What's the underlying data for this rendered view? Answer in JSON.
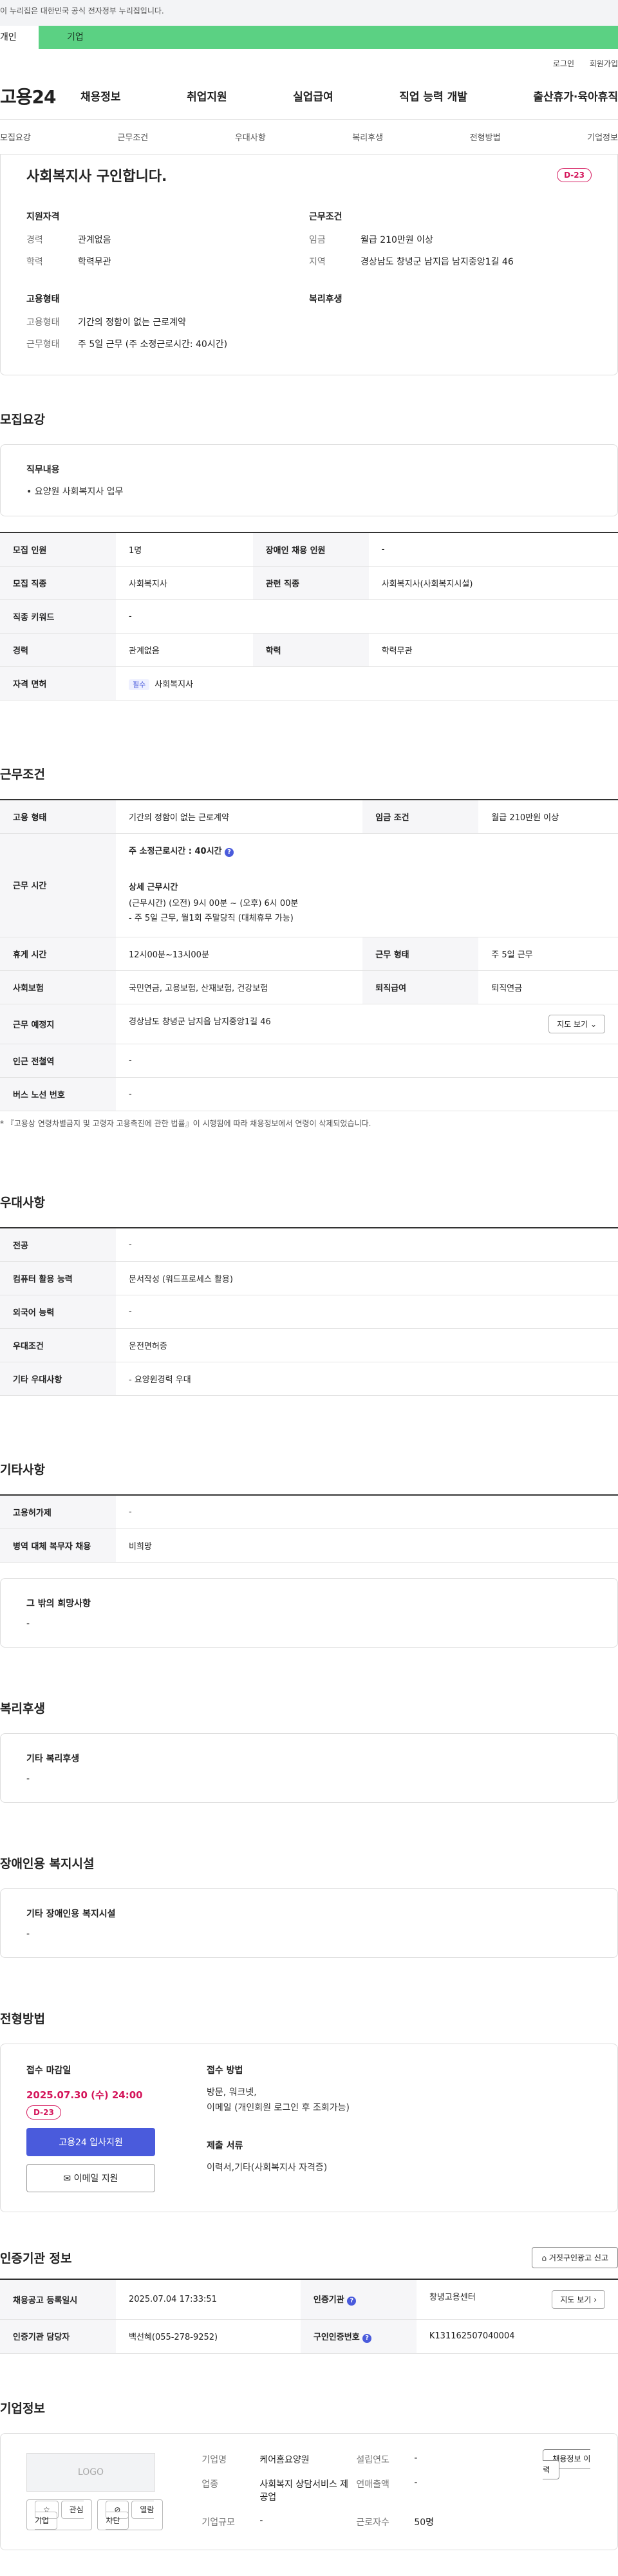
{
  "gov_banner": "이 누리집은 대한민국 공식 전자정부 누리집입니다.",
  "tabs": {
    "individual": "개인",
    "company": "기업"
  },
  "util": {
    "login": "로그인",
    "join": "회원가입"
  },
  "logo": "고용24",
  "gnb": [
    "채용정보",
    "취업지원",
    "실업급여",
    "직업 능력 개발",
    "출산휴가·육아휴직"
  ],
  "snb": [
    "모집요강",
    "근무조건",
    "우대사항",
    "복리후생",
    "전형방법",
    "기업정보"
  ],
  "summary": {
    "title": "사회복지사 구인합니다.",
    "dday": "D-23",
    "qual_title": "지원자격",
    "career_k": "경력",
    "career_v": "관계없음",
    "edu_k": "학력",
    "edu_v": "학력무관",
    "work_title": "근무조건",
    "wage_k": "임금",
    "wage_v": "월급 210만원 이상",
    "area_k": "지역",
    "area_v": "경상남도 창녕군 남지읍 남지중앙1길 46",
    "emp_title": "고용형태",
    "emptype_k": "고용형태",
    "emptype_v": "기간의 정함이 없는 근로계약",
    "worktype_k": "근무형태",
    "worktype_v": "주 5일 근무 (주 소정근로시간: 40시간)",
    "welfare_title": "복리후생"
  },
  "recruit": {
    "title": "모집요강",
    "duty_title": "직무내용",
    "duty": "• 요양원 사회복지사 업무",
    "rows": [
      [
        "모집 인원",
        "1명",
        "장애인 채용 인원",
        "-"
      ],
      [
        "모집 직종",
        "사회복지사",
        "관련 직종",
        "사회복지사(사회복지시설)"
      ],
      [
        "직종 키워드",
        "-"
      ],
      [
        "경력",
        "관계없음",
        "학력",
        "학력무관"
      ]
    ],
    "license_k": "자격 면허",
    "license_tag": "필수",
    "license_v": "사회복지사"
  },
  "work": {
    "title": "근무조건",
    "emptype_k": "고용 형태",
    "emptype_v": "기간의 정함이 없는 근로계약",
    "wage_k": "임금 조건",
    "wage_v": "월급 210만원 이상",
    "hours_k": "근무 시간",
    "hours_total": "주 소정근로시간 : 40시간",
    "hours_detail_title": "상세 근무시간",
    "hours_detail_1": "(근무시간) (오전) 9시 00분 ~ (오후) 6시 00분",
    "hours_detail_2": "- 주 5일 근무, 월1회 주말당직 (대체휴무 가능)",
    "rest_k": "휴게 시간",
    "rest_v": "12시00분~13시00분",
    "form_k": "근무 형태",
    "form_v": "주 5일 근무",
    "ins_k": "사회보험",
    "ins_v": "국민연금, 고용보험, 산재보험, 건강보험",
    "sev_k": "퇴직급여",
    "sev_v": "퇴직연금",
    "place_k": "근무 예정지",
    "place_v": "경상남도 창녕군 남지읍 남지중앙1길 46",
    "map_btn": "지도 보기",
    "subway_k": "인근 전철역",
    "subway_v": "-",
    "bus_k": "버스 노선 번호",
    "bus_v": "-",
    "note": "* 『고용상 연령차별금지 및 고령자 고용촉진에 관한 법률』이 시행됨에 따라 채용정보에서 연령이 삭제되었습니다."
  },
  "pref": {
    "title": "우대사항",
    "rows": [
      [
        "전공",
        "-"
      ],
      [
        "컴퓨터 활용 능력",
        "문서작성 (워드프로세스 활용)"
      ],
      [
        "외국어 능력",
        "-"
      ],
      [
        "우대조건",
        "운전면허증"
      ],
      [
        "기타 우대사항",
        "- 요양원경력 우대"
      ]
    ]
  },
  "etc": {
    "title": "기타사항",
    "rows": [
      [
        "고용허가제",
        "-"
      ],
      [
        "병역 대체 복무자 채용",
        "비희망"
      ]
    ],
    "other_title": "그 밖의 희망사항",
    "other_v": "-"
  },
  "welfare": {
    "title": "복리후생",
    "box_title": "기타 복리후생",
    "box_v": "-"
  },
  "disabled": {
    "title": "장애인용 복지시설",
    "box_title": "기타 장애인용 복지시설",
    "box_v": "-"
  },
  "process": {
    "title": "전형방법",
    "deadline_k": "접수 마감일",
    "deadline_v": "2025.07.30 (수) 24:00",
    "dday": "D-23",
    "apply_btn": "고용24 입사지원",
    "email_btn": "이메일 지원",
    "method_title": "접수 방법",
    "method_v1": "방문, 워크넷,",
    "method_v2": "이메일 (개인회원 로그인 후 조회가능)",
    "docs_title": "제출 서류",
    "docs_v": "이력서,기타(사회복지사 자격증)"
  },
  "cert": {
    "title": "인증기관 정보",
    "report_btn": "거짓구인광고 신고",
    "reg_k": "채용공고 등록일시",
    "reg_v": "2025.07.04 17:33:51",
    "org_k": "인증기관",
    "org_v": "창녕고용센터",
    "map_btn": "지도 보기",
    "mgr_k": "인증기관 담당자",
    "mgr_v": "백선혜(055-278-9252)",
    "num_k": "구인인증번호",
    "num_v": "K131162507040004"
  },
  "company": {
    "title": "기업정보",
    "logo": "LOGO",
    "fav_btn": "관심기업",
    "block_btn": "열람차단",
    "name_k": "기업명",
    "name_v": "케어홈요양원",
    "year_k": "설립연도",
    "year_v": "-",
    "biz_k": "업종",
    "biz_v": "사회복지 상담서비스 제공업",
    "sales_k": "연매출액",
    "sales_v": "-",
    "emp_k": "근로자수",
    "emp_v": "50명",
    "scale_k": "기업규모",
    "scale_v": "-",
    "history_btn": "채용정보 이력"
  }
}
